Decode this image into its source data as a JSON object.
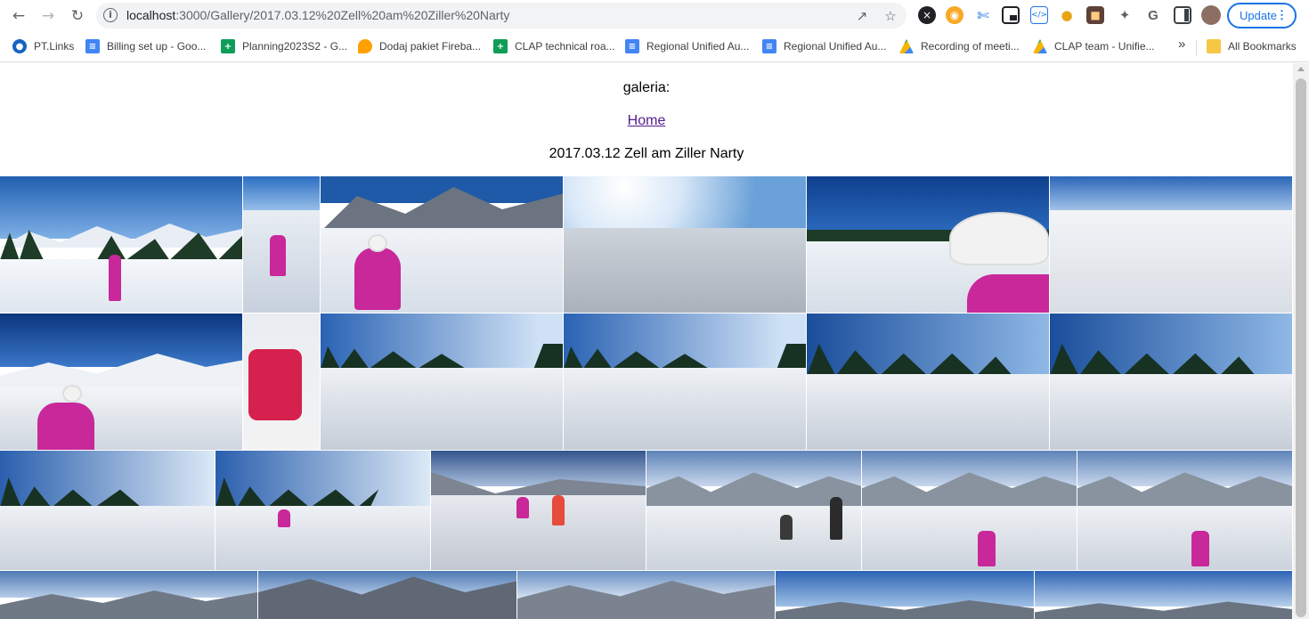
{
  "browser": {
    "url_host": "localhost",
    "url_path": ":3000/Gallery/2017.03.12%20Zell%20am%20Ziller%20Narty",
    "update_label": "Update"
  },
  "bookmarks": [
    {
      "label": "PT.Links"
    },
    {
      "label": "Billing set up - Goo..."
    },
    {
      "label": "Planning2023S2 - G..."
    },
    {
      "label": "Dodaj pakiet Fireba..."
    },
    {
      "label": "CLAP technical roa..."
    },
    {
      "label": "Regional Unified Au..."
    },
    {
      "label": "Regional Unified Au..."
    },
    {
      "label": "Recording of meeti..."
    },
    {
      "label": "CLAP team - Unifie..."
    }
  ],
  "bookmarks_overflow": "»",
  "all_bookmarks_label": "All Bookmarks",
  "page": {
    "heading": "galeria:",
    "home_link": "Home",
    "gallery_title": "2017.03.12 Zell am Ziller Narty"
  }
}
